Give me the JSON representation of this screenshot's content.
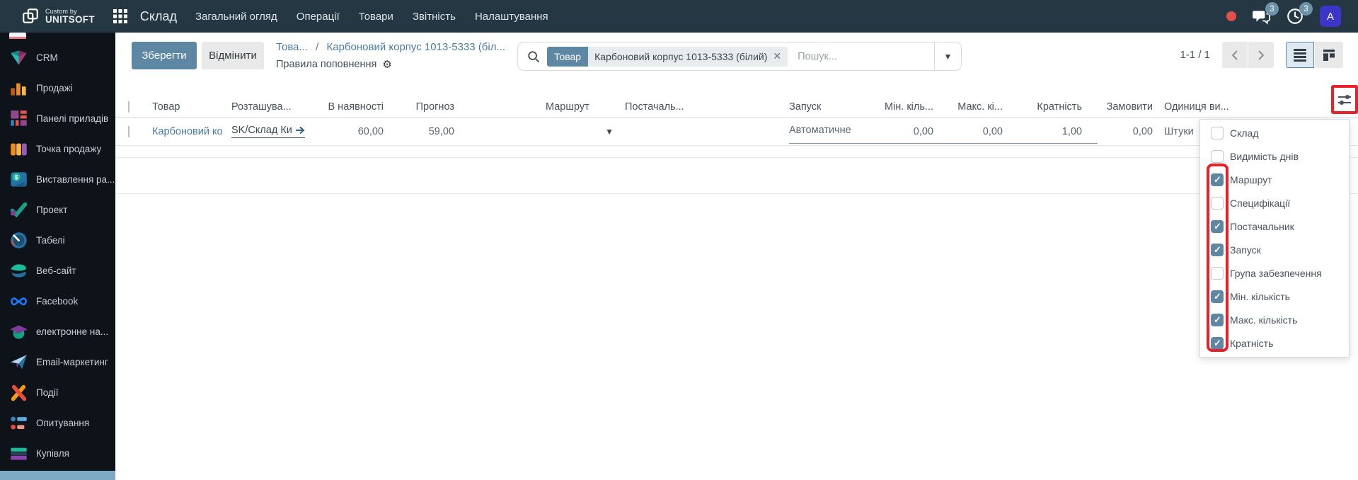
{
  "topbar": {
    "logo_small": "Custom by",
    "logo_brand": "UNITSOFT",
    "app_name": "Склад",
    "menus": [
      "Загальний огляд",
      "Операції",
      "Товари",
      "Звітність",
      "Налаштування"
    ],
    "messages_badge": "3",
    "activities_badge": "3",
    "avatar_letter": "A"
  },
  "sidebar": {
    "items": [
      {
        "label": "CRM"
      },
      {
        "label": "Продажі"
      },
      {
        "label": "Панелі приладів"
      },
      {
        "label": "Точка продажу"
      },
      {
        "label": "Виставлення ра..."
      },
      {
        "label": "Проект"
      },
      {
        "label": "Табелі"
      },
      {
        "label": "Веб-сайт"
      },
      {
        "label": "Facebook"
      },
      {
        "label": "електронне на..."
      },
      {
        "label": "Email-маркетинг"
      },
      {
        "label": "Події"
      },
      {
        "label": "Опитування"
      },
      {
        "label": "Купівля"
      }
    ]
  },
  "control_panel": {
    "save_label": "Зберегти",
    "discard_label": "Відмінити",
    "breadcrumb": {
      "parent": "Това...",
      "separator": "/",
      "current": "Карбоновий корпус 1013-5333 (біл...",
      "subtitle": "Правила поповнення"
    },
    "search": {
      "facet_label": "Товар",
      "facet_value": "Карбоновий корпус 1013-5333 (білий)",
      "remove_glyph": "✕",
      "placeholder": "Пошук...",
      "caret_glyph": "▼"
    },
    "pager": {
      "range": "1-1 / 1"
    }
  },
  "table": {
    "columns": [
      "Товар",
      "Розташува...",
      "В наявності",
      "Прогноз",
      "Маршрут",
      "Постачаль...",
      "Запуск",
      "Мін. кіль...",
      "Макс. кі...",
      "Кратність",
      "Замовити",
      "Одиниця ви..."
    ],
    "row": {
      "product": "Карбоновий ко",
      "location": "SK/Склад Ки",
      "on_hand": "60,00",
      "forecast": "59,00",
      "route_caret": "▼",
      "trigger": "Автоматичне",
      "min_qty": "0,00",
      "max_qty": "0,00",
      "multiple": "1,00",
      "to_order": "0,00",
      "uom": "Штуки"
    }
  },
  "column_dropdown": {
    "items": [
      {
        "label": "Склад",
        "checked": false
      },
      {
        "label": "Видимість днів",
        "checked": false
      },
      {
        "label": "Маршрут",
        "checked": true
      },
      {
        "label": "Специфікації",
        "checked": false
      },
      {
        "label": "Постачальник",
        "checked": true
      },
      {
        "label": "Запуск",
        "checked": true
      },
      {
        "label": "Група забезпечення",
        "checked": false
      },
      {
        "label": "Мін. кількість",
        "checked": true
      },
      {
        "label": "Макс. кількість",
        "checked": true
      },
      {
        "label": "Кратність",
        "checked": true
      }
    ]
  },
  "colors": {
    "navbar_bg": "#243742",
    "sidebar_bg": "#0d1319",
    "accent": "#5d87a2",
    "link": "#4a7ca6",
    "annotation_red": "#ec2027",
    "avatar_bg": "#3c35c8",
    "notification_dot": "#e25049"
  }
}
